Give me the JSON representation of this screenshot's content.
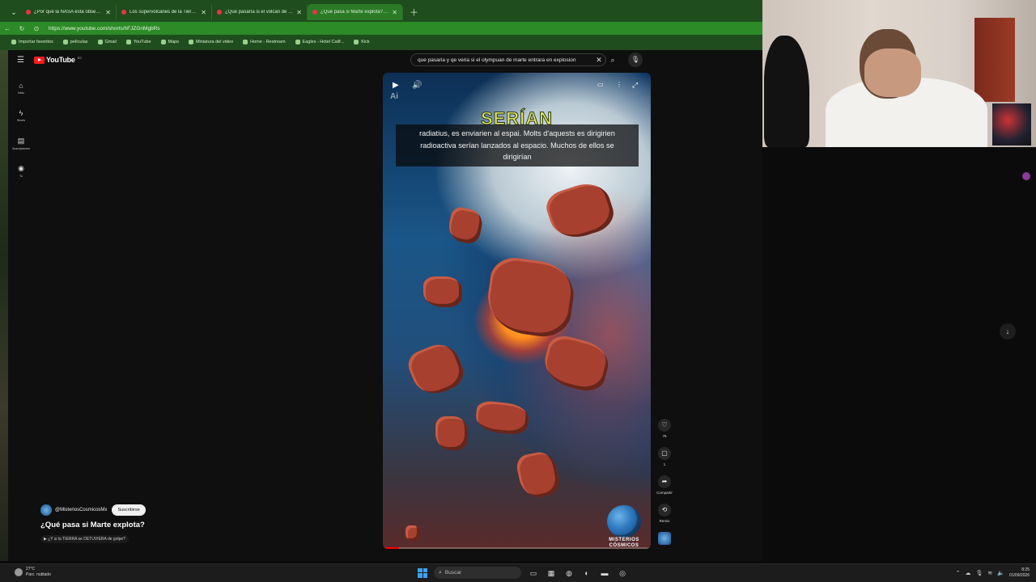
{
  "browser": {
    "tabs": [
      {
        "title": "¿Por qué la NASA está obsesionada"
      },
      {
        "title": "Los supervolcanes de la Tierra se s"
      },
      {
        "title": "¿Qué pasaría si el volcán de Yello"
      },
      {
        "title": "¿Qué pasa si Marte explota? - You"
      }
    ],
    "active_tab_index": 3,
    "url": "https://www.youtube.com/shorts/hFJZGnMgbRs",
    "bookmarks": [
      "Importar favoritos",
      "películas",
      "Gmail",
      "YouTube",
      "Maps",
      "Miniatura del video",
      "Home - Restream",
      "Eagles - Hotel Calif...",
      "Kick"
    ]
  },
  "youtube": {
    "logo_text": "YouTube",
    "country_code": "EC",
    "search_query": "que pasaria y qe veria si el olympuan de marte entrara en explosion",
    "nav": [
      {
        "icon": "home-icon",
        "label": "Inicio"
      },
      {
        "icon": "shorts-icon",
        "label": "Shorts"
      },
      {
        "icon": "subscriptions-icon",
        "label": "Suscripciones"
      },
      {
        "icon": "you-icon",
        "label": "Tú"
      }
    ],
    "player": {
      "ai_mark": "Ai",
      "overlay_word": "SERÍAN",
      "captions": [
        "radiatius, es enviarien al espai. Molts d'aquests es dirigirien",
        "radioactiva serían lanzados al espacio. Muchos de ellos se",
        "dirigirían"
      ],
      "badge_text": [
        "MISTERIOS",
        "CÓSMICOS"
      ],
      "progress_fraction": 0.06
    },
    "actions": [
      {
        "icon": "like-icon",
        "label": "75"
      },
      {
        "icon": "comment-icon",
        "label": "1"
      },
      {
        "icon": "share-icon",
        "label": "Compartir"
      },
      {
        "icon": "remix-icon",
        "label": "Remix"
      }
    ],
    "meta": {
      "channel": "@MisteriosCosmicosMx",
      "subscribe_label": "Suscribirse",
      "title": "¿Qué pasa si Marte explota?",
      "related": "¿Y si la TIERRA se DETUVIERA de golpe?"
    }
  },
  "taskbar": {
    "temp": "27°C",
    "weather": "Parc. nublado",
    "search_label": "Buscar",
    "time": "8:25",
    "date": "01/09/2026"
  }
}
